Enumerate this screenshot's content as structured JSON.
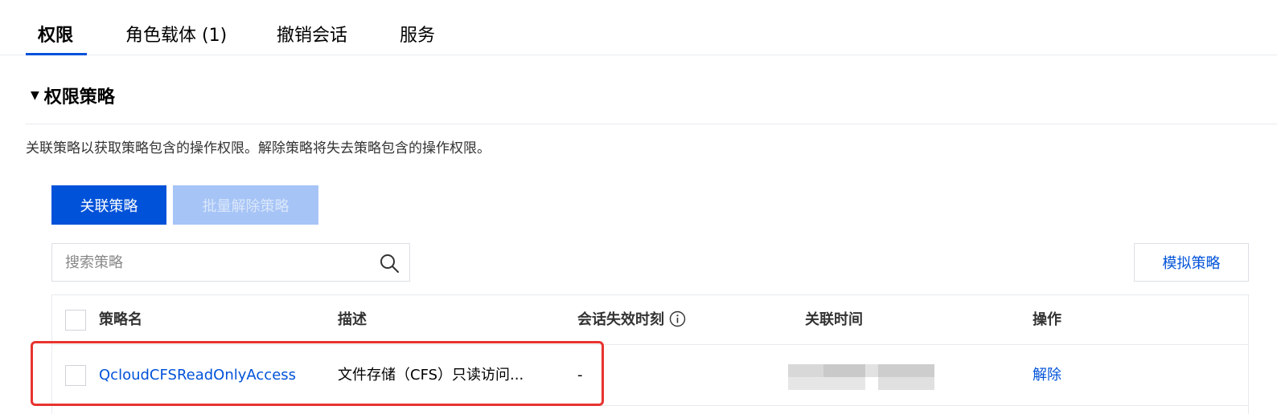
{
  "tabs": [
    {
      "label": "权限",
      "active": true
    },
    {
      "label": "角色载体 (1)"
    },
    {
      "label": "撤销会话"
    },
    {
      "label": "服务"
    }
  ],
  "section": {
    "title": "权限策略",
    "description": "关联策略以获取策略包含的操作权限。解除策略将失去策略包含的操作权限。"
  },
  "toolbar": {
    "attach_label": "关联策略",
    "batch_detach_label": "批量解除策略",
    "simulate_label": "模拟策略"
  },
  "search": {
    "placeholder": "搜索策略",
    "icon": "search-icon"
  },
  "table": {
    "columns": [
      "策略名",
      "描述",
      "会话失效时刻",
      "关联时间",
      "操作"
    ],
    "rows": [
      {
        "name": "QcloudCFSReadOnlyAccess",
        "description": "文件存储（CFS）只读访问...",
        "session_expiry": "-",
        "action": "解除"
      }
    ]
  },
  "colors": {
    "primary": "#0052d9",
    "primary_disabled": "#a6c4f6",
    "highlight": "#e8332f",
    "border": "#e7eaef"
  }
}
